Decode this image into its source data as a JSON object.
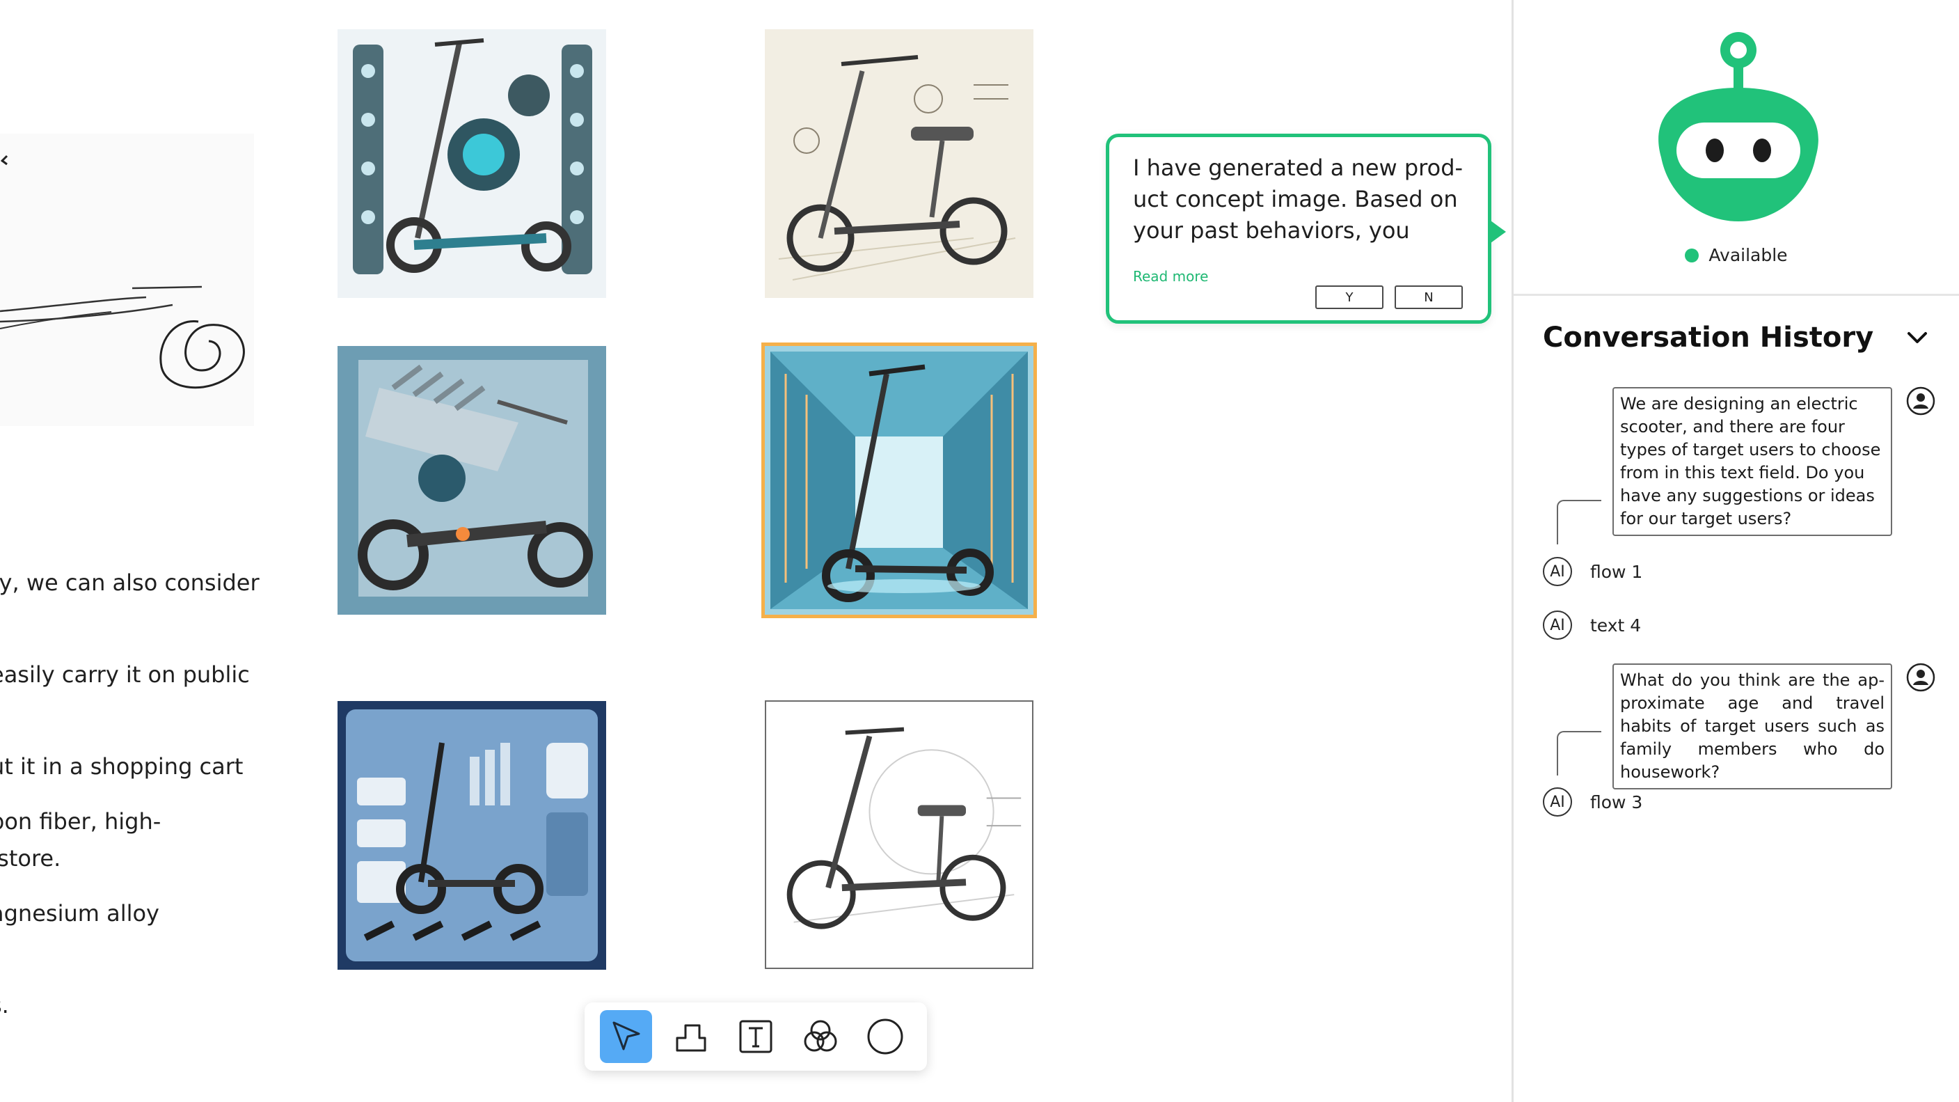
{
  "canvas": {
    "text_blocks": [
      {
        "lines": [
          "ty, we can also consider",
          "easily carry it on public",
          "ut it in a shopping cart",
          " store."
        ]
      },
      {
        "lines": [
          "bon fiber, high-",
          "agnesium alloy",
          "s."
        ]
      }
    ]
  },
  "bubble": {
    "message": "I have generated a new prod-uct concept image. Based on your past behaviors, you may...",
    "read_more": "Read more",
    "yes": "Y",
    "no": "N"
  },
  "toolbar": {
    "tools": [
      {
        "name": "select",
        "icon": "cursor-arrow-icon",
        "active": true
      },
      {
        "name": "shape",
        "icon": "stack-shape-icon",
        "active": false
      },
      {
        "name": "text",
        "icon": "text-box-icon",
        "active": false
      },
      {
        "name": "blend",
        "icon": "three-circles-icon",
        "active": false
      },
      {
        "name": "circle",
        "icon": "circle-icon",
        "active": false
      }
    ]
  },
  "panel": {
    "status": "Available",
    "history_title": "Conversation History",
    "messages": [
      {
        "role": "user",
        "text": "We are designing an electric scooter, and there are four types of target users to choose from in this text field. Do you have any suggestions or ideas for our target users?"
      },
      {
        "role": "ai",
        "badge": "AI",
        "label": "flow 1"
      },
      {
        "role": "ai",
        "badge": "AI",
        "label": "text 4"
      },
      {
        "role": "user",
        "text": "What do you think are the ap-proximate age and travel habits of target users such as family members who do housework?"
      },
      {
        "role": "ai",
        "badge": "AI",
        "label": "flow 3"
      }
    ]
  },
  "colors": {
    "accent_green": "#21c27a",
    "select_blue": "#55aaf5",
    "selected_outline": "#f5b04a"
  }
}
